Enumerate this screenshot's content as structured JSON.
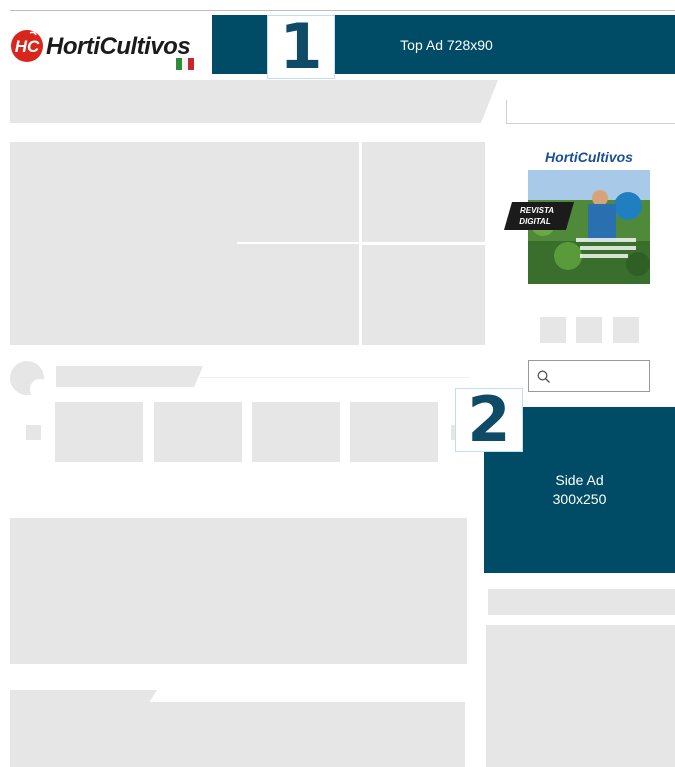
{
  "brand": {
    "name_part1": "Horti",
    "name_part2": "Cultivos",
    "monogram": "HC",
    "flag_colors": [
      "#2e8b3a",
      "#f2f2f2",
      "#c8262c"
    ]
  },
  "ads": {
    "top_ad": "Top Ad 728x90",
    "side_ad_line1": "Side Ad",
    "side_ad_line2": "300x250"
  },
  "markers": {
    "one": "1",
    "two": "2"
  },
  "magazine": {
    "title": "HortiCultivos",
    "badge_line1": "REVISTA",
    "badge_line2": "DIGITAL"
  },
  "search": {
    "icon": "search-icon"
  },
  "colors": {
    "ad_background": "#004c66",
    "placeholder_gray": "#e6e6e6",
    "brand_red": "#d9261c"
  }
}
